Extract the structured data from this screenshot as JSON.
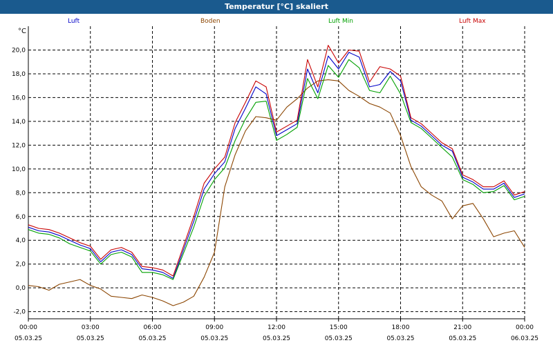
{
  "title": "Temperatur [°C] skaliert",
  "y_unit": "°C",
  "colors": {
    "title_bg": "#1a5a8e",
    "Luft": "#0000c8",
    "Boden": "#8b4500",
    "Luft Min": "#00a000",
    "Luft Max": "#c80000",
    "grid": "#000000"
  },
  "legend": [
    {
      "name": "Luft",
      "color": "#0000c8"
    },
    {
      "name": "Boden",
      "color": "#8b4500"
    },
    {
      "name": "Luft Min",
      "color": "#00a000"
    },
    {
      "name": "Luft Max",
      "color": "#c80000"
    }
  ],
  "chart_data": {
    "type": "line",
    "title": "Temperatur [°C] skaliert",
    "ylabel": "°C",
    "xlabel": "",
    "ylim": [
      -2.6,
      22.0
    ],
    "xlim": [
      0,
      24
    ],
    "y_ticks": [
      "-2,0",
      "0,0",
      "2,0",
      "4,0",
      "6,0",
      "8,0",
      "10,0",
      "12,0",
      "14,0",
      "16,0",
      "18,0",
      "20,0"
    ],
    "y_tick_values": [
      -2,
      0,
      2,
      4,
      6,
      8,
      10,
      12,
      14,
      16,
      18,
      20
    ],
    "x_ticks": [
      {
        "time": "00:00",
        "date": "05.03.25"
      },
      {
        "time": "03:00",
        "date": "05.03.25"
      },
      {
        "time": "06:00",
        "date": "05.03.25"
      },
      {
        "time": "09:00",
        "date": "05.03.25"
      },
      {
        "time": "12:00",
        "date": "05.03.25"
      },
      {
        "time": "15:00",
        "date": "05.03.25"
      },
      {
        "time": "18:00",
        "date": "05.03.25"
      },
      {
        "time": "21:00",
        "date": "05.03.25"
      },
      {
        "time": "00:00",
        "date": "06.03.25"
      }
    ],
    "grid": true,
    "legend_position": "top",
    "series": [
      {
        "name": "Luft",
        "color": "#0000c8",
        "x": [
          0,
          0.5,
          1,
          1.5,
          2,
          2.5,
          3,
          3.5,
          4,
          4.5,
          5,
          5.5,
          6,
          6.5,
          7,
          7.5,
          8,
          8.5,
          9,
          9.5,
          10,
          10.5,
          11,
          11.5,
          12,
          12.5,
          13,
          13.5,
          14,
          14.5,
          15,
          15.5,
          16,
          16.5,
          17,
          17.5,
          18,
          18.5,
          19,
          19.5,
          20,
          20.5,
          21,
          21.5,
          22,
          22.5,
          23,
          23.5,
          24
        ],
        "y": [
          5.1,
          4.8,
          4.7,
          4.4,
          4.0,
          3.6,
          3.3,
          2.2,
          3.0,
          3.2,
          2.8,
          1.6,
          1.5,
          1.3,
          0.8,
          3.2,
          5.6,
          8.3,
          9.6,
          10.6,
          13.4,
          15.1,
          16.9,
          16.3,
          12.8,
          13.3,
          13.8,
          18.4,
          16.4,
          19.5,
          18.4,
          19.8,
          19.4,
          16.9,
          17.1,
          18.2,
          17.4,
          14.1,
          13.6,
          12.8,
          12.0,
          11.5,
          9.3,
          8.9,
          8.3,
          8.3,
          8.8,
          7.6,
          7.9
        ]
      },
      {
        "name": "Boden",
        "color": "#8b4500",
        "x": [
          0,
          0.5,
          1,
          1.5,
          2,
          2.5,
          3,
          3.5,
          4,
          4.5,
          5,
          5.5,
          6,
          6.5,
          7,
          7.5,
          8,
          8.5,
          9,
          9.5,
          10,
          10.5,
          11,
          11.5,
          12,
          12.5,
          13,
          13.5,
          14,
          14.5,
          15,
          15.5,
          16,
          16.5,
          17,
          17.5,
          18,
          18.5,
          19,
          19.5,
          20,
          20.5,
          21,
          21.5,
          22,
          22.5,
          23,
          23.5,
          24
        ],
        "y": [
          0.2,
          0.1,
          -0.2,
          0.3,
          0.5,
          0.7,
          0.2,
          -0.1,
          -0.7,
          -0.8,
          -0.9,
          -0.6,
          -0.8,
          -1.1,
          -1.5,
          -1.2,
          -0.7,
          0.9,
          3.0,
          8.5,
          11.2,
          13.2,
          14.4,
          14.3,
          14.1,
          15.2,
          15.9,
          16.8,
          17.4,
          17.5,
          17.4,
          16.6,
          16.1,
          15.5,
          15.2,
          14.7,
          12.8,
          10.2,
          8.5,
          7.8,
          7.3,
          5.8,
          6.9,
          7.1,
          5.8,
          4.3,
          4.6,
          4.8,
          3.4
        ]
      },
      {
        "name": "Luft Min",
        "color": "#00a000",
        "x": [
          0,
          0.5,
          1,
          1.5,
          2,
          2.5,
          3,
          3.5,
          4,
          4.5,
          5,
          5.5,
          6,
          6.5,
          7,
          7.5,
          8,
          8.5,
          9,
          9.5,
          10,
          10.5,
          11,
          11.5,
          12,
          12.5,
          13,
          13.5,
          14,
          14.5,
          15,
          15.5,
          16,
          16.5,
          17,
          17.5,
          18,
          18.5,
          19,
          19.5,
          20,
          20.5,
          21,
          21.5,
          22,
          22.5,
          23,
          23.5,
          24
        ],
        "y": [
          4.9,
          4.6,
          4.5,
          4.2,
          3.7,
          3.4,
          3.1,
          2.0,
          2.8,
          3.0,
          2.6,
          1.3,
          1.3,
          1.1,
          0.7,
          2.9,
          5.1,
          7.7,
          9.1,
          10.1,
          12.4,
          14.2,
          15.6,
          15.7,
          12.4,
          12.9,
          13.5,
          17.6,
          15.9,
          18.7,
          17.7,
          19.2,
          18.5,
          16.6,
          16.4,
          17.8,
          16.3,
          13.9,
          13.4,
          12.6,
          11.8,
          11.0,
          9.1,
          8.7,
          8.0,
          8.1,
          8.6,
          7.4,
          7.7
        ]
      },
      {
        "name": "Luft Max",
        "color": "#c80000",
        "x": [
          0,
          0.5,
          1,
          1.5,
          2,
          2.5,
          3,
          3.5,
          4,
          4.5,
          5,
          5.5,
          6,
          6.5,
          7,
          7.5,
          8,
          8.5,
          9,
          9.5,
          10,
          10.5,
          11,
          11.5,
          12,
          12.5,
          13,
          13.5,
          14,
          14.5,
          15,
          15.5,
          16,
          16.5,
          17,
          17.5,
          18,
          18.5,
          19,
          19.5,
          20,
          20.5,
          21,
          21.5,
          22,
          22.5,
          23,
          23.5,
          24
        ],
        "y": [
          5.3,
          5.0,
          4.9,
          4.6,
          4.2,
          3.8,
          3.5,
          2.4,
          3.2,
          3.4,
          3.0,
          1.8,
          1.7,
          1.5,
          1.0,
          3.5,
          6.0,
          8.8,
          10.0,
          11.0,
          13.9,
          15.6,
          17.4,
          16.9,
          13.1,
          13.6,
          14.1,
          19.2,
          16.9,
          20.4,
          18.9,
          20.0,
          19.9,
          17.3,
          18.6,
          18.4,
          17.8,
          14.3,
          13.8,
          13.0,
          12.2,
          11.7,
          9.5,
          9.1,
          8.5,
          8.5,
          9.0,
          7.8,
          8.1
        ]
      }
    ]
  }
}
